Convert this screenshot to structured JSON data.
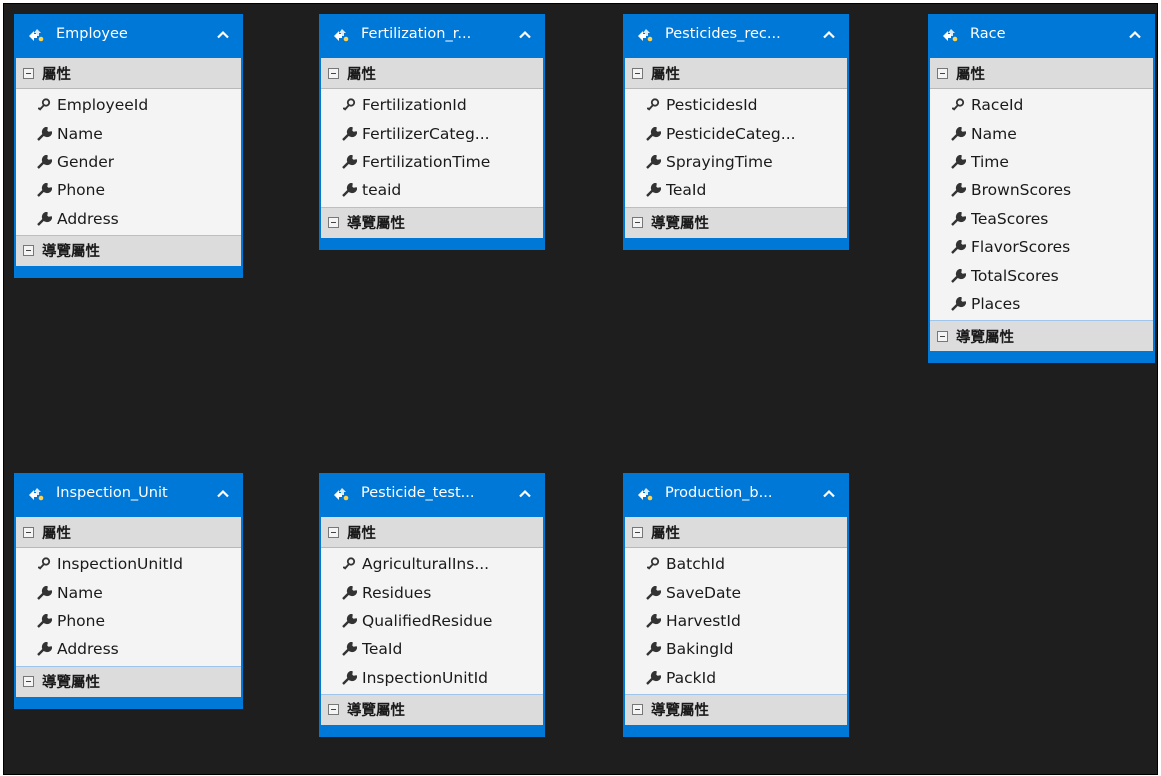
{
  "section_labels": {
    "properties": "屬性",
    "navigation": "導覽屬性"
  },
  "entities": [
    {
      "title": "Employee",
      "properties": [
        "EmployeeId",
        "Name",
        "Gender",
        "Phone",
        "Address"
      ]
    },
    {
      "title": "Fertilization_r...",
      "properties": [
        "FertilizationId",
        "FertilizerCateg...",
        "FertilizationTime",
        "teaid"
      ]
    },
    {
      "title": "Pesticides_rec...",
      "properties": [
        "PesticidesId",
        "PesticideCateg...",
        "SprayingTime",
        "TeaId"
      ]
    },
    {
      "title": "Race",
      "properties": [
        "RaceId",
        "Name",
        "Time",
        "BrownScores",
        "TeaScores",
        "FlavorScores",
        "TotalScores",
        "Places"
      ]
    },
    {
      "title": "Inspection_Unit",
      "properties": [
        "InspectionUnitId",
        "Name",
        "Phone",
        "Address"
      ]
    },
    {
      "title": "Pesticide_test...",
      "properties": [
        "AgriculturalIns...",
        "Residues",
        "QualifiedResidue",
        "TeaId",
        "InspectionUnitId"
      ]
    },
    {
      "title": "Production_b...",
      "properties": [
        "BatchId",
        "SaveDate",
        "HarvestId",
        "BakingId",
        "PackId"
      ]
    }
  ],
  "colors": {
    "header": "#0078d7",
    "canvas": "#1e1e1e",
    "section": "#dcdcdc"
  }
}
